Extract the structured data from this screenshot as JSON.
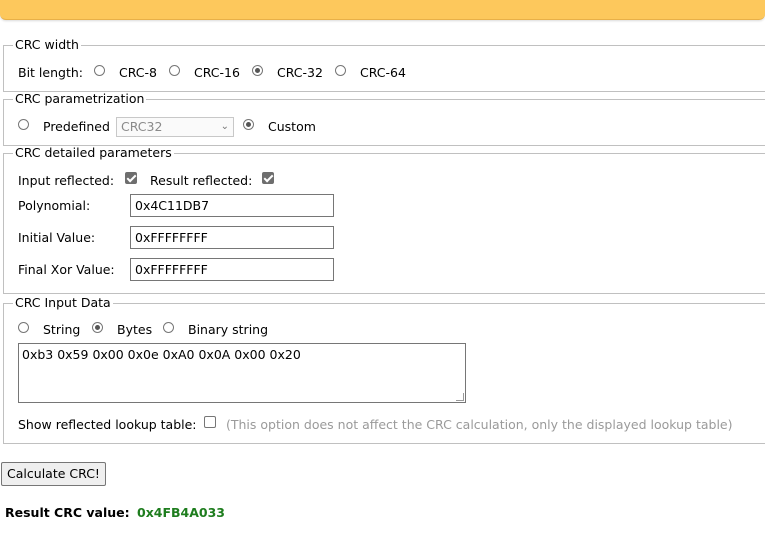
{
  "width_section": {
    "legend": "CRC width",
    "label": "Bit length:",
    "options": [
      "CRC-8",
      "CRC-16",
      "CRC-32",
      "CRC-64"
    ],
    "selected": "CRC-32"
  },
  "param_section": {
    "legend": "CRC parametrization",
    "predefined_label": "Predefined",
    "predefined_value": "CRC32",
    "custom_label": "Custom",
    "selected": "Custom"
  },
  "detail_section": {
    "legend": "CRC detailed parameters",
    "input_reflected_label": "Input reflected:",
    "input_reflected": true,
    "result_reflected_label": "Result reflected:",
    "result_reflected": true,
    "polynomial_label": "Polynomial:",
    "polynomial": "0x4C11DB7",
    "initial_label": "Initial Value:",
    "initial": "0xFFFFFFFF",
    "final_xor_label": "Final Xor Value:",
    "final_xor": "0xFFFFFFFF"
  },
  "input_section": {
    "legend": "CRC Input Data",
    "options": [
      "String",
      "Bytes",
      "Binary string"
    ],
    "selected": "Bytes",
    "data": "0xb3 0x59 0x00 0x0e 0xA0 0x0A 0x00 0x20",
    "lookup_label": "Show reflected lookup table:",
    "lookup_checked": false,
    "lookup_note": "(This option does not affect the CRC calculation, only the displayed lookup table)"
  },
  "calculate_button": "Calculate CRC!",
  "result": {
    "label": "Result CRC value:",
    "value": "0x4FB4A033"
  },
  "colors": {
    "topbar": "#fdc85c",
    "result_value": "#1e7d1e",
    "note": "#9a9a9a"
  }
}
